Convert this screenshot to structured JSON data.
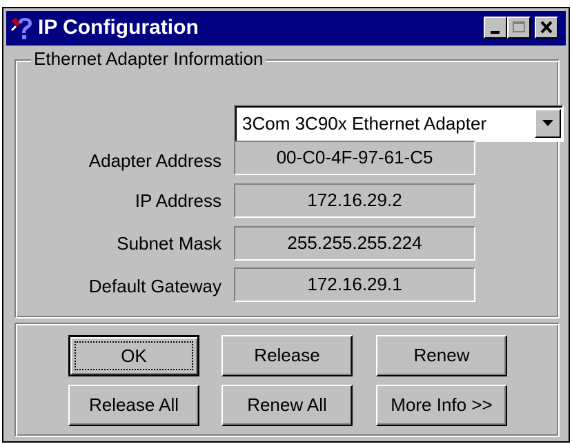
{
  "window": {
    "title": "IP Configuration",
    "title_icon": "help-question-icon",
    "controls": [
      "minimize-icon",
      "maximize-icon",
      "close-icon"
    ]
  },
  "adapter_group": {
    "label": "Ethernet  Adapter Information",
    "adapter_select": {
      "selected": "3Com 3C90x Ethernet Adapter"
    },
    "fields": {
      "adapter_address": {
        "label": "Adapter Address",
        "value": "00-C0-4F-97-61-C5"
      },
      "ip_address": {
        "label": "IP Address",
        "value": "172.16.29.2"
      },
      "subnet_mask": {
        "label": "Subnet Mask",
        "value": "255.255.255.224"
      },
      "default_gateway": {
        "label": "Default Gateway",
        "value": "172.16.29.1"
      }
    }
  },
  "buttons": {
    "ok": "OK",
    "release": "Release",
    "renew": "Renew",
    "release_all": "Release All",
    "renew_all": "Renew All",
    "more_info": "More Info >>"
  },
  "colors": {
    "titlebar": "#000080",
    "face": "#c0c0c0"
  }
}
